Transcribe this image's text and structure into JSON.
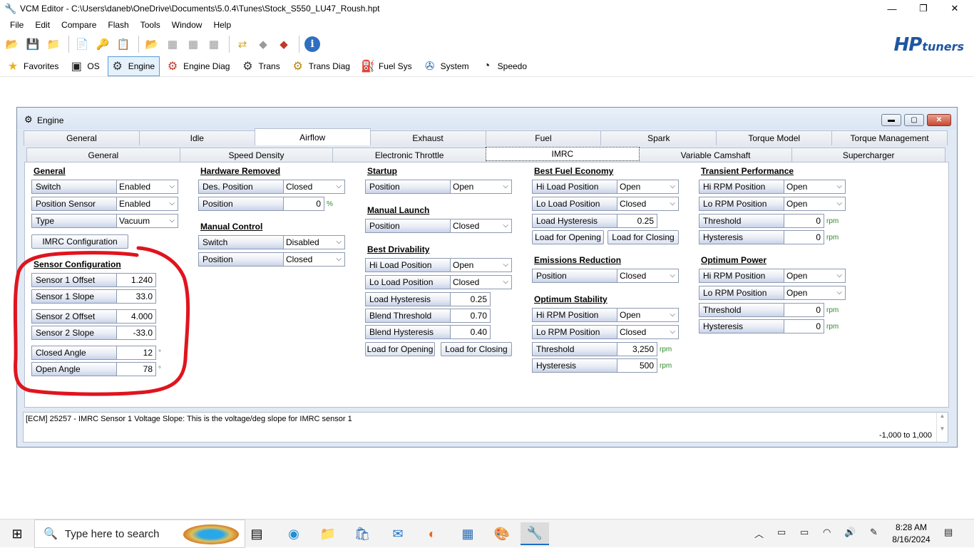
{
  "window": {
    "title": "VCM Editor - C:\\Users\\daneb\\OneDrive\\Documents\\5.0.4\\Tunes\\Stock_S550_LU47_Roush.hpt",
    "minimize": "—",
    "maximize": "❐",
    "close": "✕"
  },
  "menu": [
    "File",
    "Edit",
    "Compare",
    "Flash",
    "Tools",
    "Window",
    "Help"
  ],
  "logo": {
    "hp": "HP",
    "tuners": "tuners"
  },
  "modules": [
    {
      "label": "Favorites",
      "icon": "star-icon",
      "glyph": "★",
      "color": "#e8b21f"
    },
    {
      "label": "OS",
      "icon": "chip-icon",
      "glyph": "▣",
      "color": "#222"
    },
    {
      "label": "Engine",
      "icon": "engine-icon",
      "glyph": "⚙",
      "color": "#333"
    },
    {
      "label": "Engine Diag",
      "icon": "engine-diag-icon",
      "glyph": "⚙",
      "color": "#c0392b"
    },
    {
      "label": "Trans",
      "icon": "gear-icon",
      "glyph": "⚙",
      "color": "#333"
    },
    {
      "label": "Trans Diag",
      "icon": "gear-diag-icon",
      "glyph": "⚙",
      "color": "#b8860b"
    },
    {
      "label": "Fuel Sys",
      "icon": "fuel-pump-icon",
      "glyph": "⛽",
      "color": "#222"
    },
    {
      "label": "System",
      "icon": "fan-icon",
      "glyph": "✇",
      "color": "#2b6cb0"
    },
    {
      "label": "Speedo",
      "icon": "speedometer-icon",
      "glyph": "◔",
      "color": "#222"
    }
  ],
  "engine": {
    "title": "Engine",
    "tabs1": [
      "General",
      "Idle",
      "Airflow",
      "Exhaust",
      "Fuel",
      "Spark",
      "Torque Model",
      "Torque Management"
    ],
    "tabs2": [
      "General",
      "Speed Density",
      "Electronic Throttle",
      "IMRC",
      "Variable Camshaft",
      "Supercharger"
    ],
    "general": {
      "title": "General",
      "switch_label": "Switch",
      "switch_value": "Enabled",
      "possensor_label": "Position Sensor",
      "possensor_value": "Enabled",
      "type_label": "Type",
      "type_value": "Vacuum",
      "imrc_config": "IMRC Configuration"
    },
    "sensor_config": {
      "title": "Sensor Configuration",
      "s1o_label": "Sensor 1 Offset",
      "s1o_value": "1.240",
      "s1s_label": "Sensor 1 Slope",
      "s1s_value": "33.0",
      "s2o_label": "Sensor 2 Offset",
      "s2o_value": "4.000",
      "s2s_label": "Sensor 2 Slope",
      "s2s_value": "-33.0",
      "ca_label": "Closed Angle",
      "ca_value": "12",
      "ca_unit": "°",
      "oa_label": "Open Angle",
      "oa_value": "78",
      "oa_unit": "°"
    },
    "hardware_removed": {
      "title": "Hardware Removed",
      "des_label": "Des. Position",
      "des_value": "Closed",
      "pos_label": "Position",
      "pos_value": "0",
      "pos_unit": "%"
    },
    "manual_control": {
      "title": "Manual Control",
      "switch_label": "Switch",
      "switch_value": "Disabled",
      "pos_label": "Position",
      "pos_value": "Closed"
    },
    "startup": {
      "title": "Startup",
      "pos_label": "Position",
      "pos_value": "Open"
    },
    "manual_launch": {
      "title": "Manual Launch",
      "pos_label": "Position",
      "pos_value": "Closed"
    },
    "best_drivability": {
      "title": "Best Drivability",
      "hi_label": "Hi Load Position",
      "hi_value": "Open",
      "lo_label": "Lo Load Position",
      "lo_value": "Closed",
      "lh_label": "Load Hysteresis",
      "lh_value": "0.25",
      "bt_label": "Blend Threshold",
      "bt_value": "0.70",
      "bh_label": "Blend Hysteresis",
      "bh_value": "0.40",
      "lfo": "Load for Opening",
      "lfc": "Load for Closing"
    },
    "best_fuel": {
      "title": "Best Fuel Economy",
      "hi_label": "Hi Load Position",
      "hi_value": "Open",
      "lo_label": "Lo Load Position",
      "lo_value": "Closed",
      "lh_label": "Load Hysteresis",
      "lh_value": "0.25",
      "lfo": "Load for Opening",
      "lfc": "Load for Closing"
    },
    "emissions": {
      "title": "Emissions Reduction",
      "pos_label": "Position",
      "pos_value": "Closed"
    },
    "optimum_stability": {
      "title": "Optimum Stability",
      "hi_label": "Hi RPM Position",
      "hi_value": "Open",
      "lo_label": "Lo RPM Position",
      "lo_value": "Closed",
      "th_label": "Threshold",
      "th_value": "3,250",
      "th_unit": "rpm",
      "hy_label": "Hysteresis",
      "hy_value": "500",
      "hy_unit": "rpm"
    },
    "transient": {
      "title": "Transient Performance",
      "hi_label": "Hi RPM Position",
      "hi_value": "Open",
      "lo_label": "Lo RPM Position",
      "lo_value": "Open",
      "th_label": "Threshold",
      "th_value": "0",
      "th_unit": "rpm",
      "hy_label": "Hysteresis",
      "hy_value": "0",
      "hy_unit": "rpm"
    },
    "optimum_power": {
      "title": "Optimum Power",
      "hi_label": "Hi RPM Position",
      "hi_value": "Open",
      "lo_label": "Lo RPM Position",
      "lo_value": "Open",
      "th_label": "Threshold",
      "th_value": "0",
      "th_unit": "rpm",
      "hy_label": "Hysteresis",
      "hy_value": "0",
      "hy_unit": "rpm"
    },
    "description": "[ECM] 25257 - IMRC Sensor 1 Voltage Slope: This is the voltage/deg slope for IMRC sensor 1",
    "range": "-1,000 to 1,000"
  },
  "taskbar": {
    "search_placeholder": "Type here to search",
    "time": "8:28 AM",
    "date": "8/16/2024"
  },
  "colors": {
    "accent_blue": "#1e56a0",
    "marker_red": "#e0141e",
    "unit_green": "#2e8b2e"
  }
}
